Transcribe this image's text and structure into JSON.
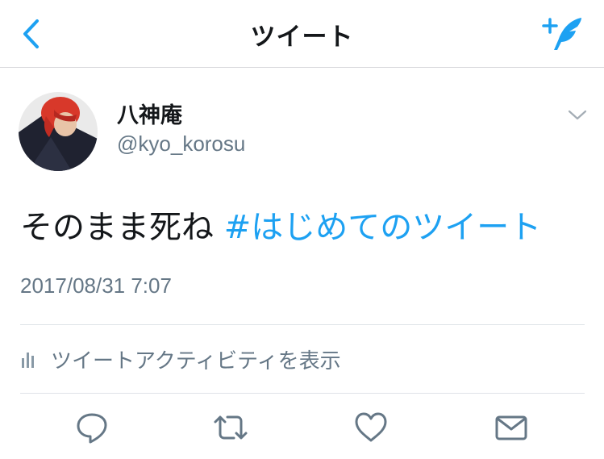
{
  "header": {
    "title": "ツイート",
    "back_icon": "chevron-left-icon",
    "compose_icon": "compose-tweet-icon",
    "accent_color": "#1da1f2"
  },
  "tweet": {
    "display_name": "八神庵",
    "handle": "@kyo_korosu",
    "text": "そのまま死ね",
    "hashtag": "#はじめてのツイート",
    "timestamp": "2017/08/31 7:07"
  },
  "activity": {
    "label": "ツイートアクティビティを表示",
    "icon": "bar-chart-icon"
  },
  "actions": {
    "reply_icon": "reply-icon",
    "retweet_icon": "retweet-icon",
    "like_icon": "heart-icon",
    "share_icon": "mail-icon"
  }
}
